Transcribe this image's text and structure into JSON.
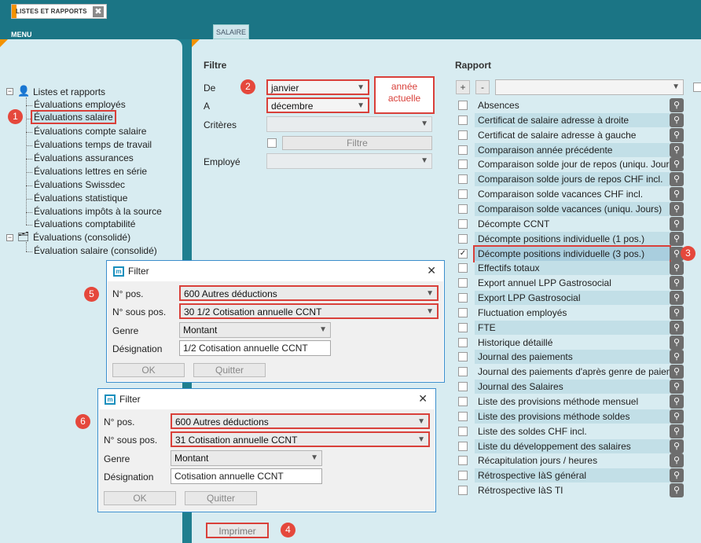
{
  "app": {
    "tab_label": "LISTES ET RAPPORTS",
    "tab_close": "✖",
    "menu_label": "MENU",
    "main_tab": "SALAIRE"
  },
  "sidebar": {
    "root": "Listes et rapports",
    "items": [
      "Évaluations employés",
      "Évaluations salaire",
      "Évaluations compte salaire",
      "Évaluations temps de travail",
      "Évaluations assurances",
      "Évaluations lettres en série",
      "Évaluations Swissdec",
      "Évaluations statistique",
      "Évaluations impôts à la source",
      "Évaluations comptabilité"
    ],
    "root2": "Évaluations (consolidé)",
    "items2": [
      "Évaluation salaire (consolidé)"
    ]
  },
  "filtre": {
    "title": "Filtre",
    "de_label": "De",
    "de_value": "janvier",
    "a_label": "A",
    "a_value": "décembre",
    "criteres_label": "Critères",
    "criteres_value": "",
    "filtre_button": "Filtre",
    "employe_label": "Employé",
    "employe_value": "",
    "annotation": "année actuelle",
    "print_button": "Imprimer"
  },
  "rapport": {
    "title": "Rapport",
    "plus": "+",
    "minus": "-",
    "select_value": "",
    "items": [
      {
        "label": "Absences",
        "checked": false
      },
      {
        "label": "Certificat de salaire adresse à droite",
        "checked": false
      },
      {
        "label": "Certificat de salaire adresse à gauche",
        "checked": false
      },
      {
        "label": "Comparaison année précédente",
        "checked": false
      },
      {
        "label": "Comparaison solde jour de repos (uniqu. Jours)",
        "checked": false
      },
      {
        "label": "Comparaison solde jours de repos CHF incl.",
        "checked": false
      },
      {
        "label": "Comparaison solde vacances CHF incl.",
        "checked": false
      },
      {
        "label": "Comparaison solde vacances (uniqu. Jours)",
        "checked": false
      },
      {
        "label": "Décompte CCNT",
        "checked": false
      },
      {
        "label": "Décompte positions individuelle (1 pos.)",
        "checked": false
      },
      {
        "label": "Décompte positions individuelle (3 pos.)",
        "checked": true
      },
      {
        "label": "Effectifs totaux",
        "checked": false
      },
      {
        "label": "Export annuel LPP Gastrosocial",
        "checked": false
      },
      {
        "label": "Export LPP Gastrosocial",
        "checked": false
      },
      {
        "label": "Fluctuation employés",
        "checked": false
      },
      {
        "label": "FTE",
        "checked": false
      },
      {
        "label": "Historique détaillé",
        "checked": false
      },
      {
        "label": "Journal des paiements",
        "checked": false
      },
      {
        "label": "Journal des paiements d'après genre de paiement",
        "checked": false
      },
      {
        "label": "Journal des Salaires",
        "checked": false
      },
      {
        "label": "Liste des provisions méthode mensuel",
        "checked": false
      },
      {
        "label": "Liste des provisions méthode soldes",
        "checked": false
      },
      {
        "label": "Liste des soldes CHF incl.",
        "checked": false
      },
      {
        "label": "Liste du développement des salaires",
        "checked": false
      },
      {
        "label": "Récapitulation jours / heures",
        "checked": false
      },
      {
        "label": "Rétrospective IàS général",
        "checked": false
      },
      {
        "label": "Rétrospective IàS TI",
        "checked": false
      }
    ]
  },
  "filter_dialog_1": {
    "title": "Filter",
    "close": "✕",
    "npos_label": "N° pos.",
    "npos_value": "600 Autres déductions",
    "nsouspos_label": "N° sous pos.",
    "nsouspos_value": "30 1/2 Cotisation annuelle CCNT",
    "genre_label": "Genre",
    "genre_value": "Montant",
    "designation_label": "Désignation",
    "designation_value": "1/2 Cotisation annuelle CCNT",
    "ok": "OK",
    "quit": "Quitter"
  },
  "filter_dialog_2": {
    "title": "Filter",
    "close": "✕",
    "npos_label": "N° pos.",
    "npos_value": "600 Autres déductions",
    "nsouspos_label": "N° sous pos.",
    "nsouspos_value": "31 Cotisation annuelle CCNT",
    "genre_label": "Genre",
    "genre_value": "Montant",
    "designation_label": "Désignation",
    "designation_value": "Cotisation annuelle CCNT",
    "ok": "OK",
    "quit": "Quitter"
  },
  "badges": [
    "1",
    "2",
    "3",
    "4",
    "5",
    "6"
  ],
  "colors": {
    "accent": "#f39200",
    "annotation_red": "#d9403a",
    "panel_bg": "#d8ecf1",
    "frame_bg": "#1b7585"
  }
}
